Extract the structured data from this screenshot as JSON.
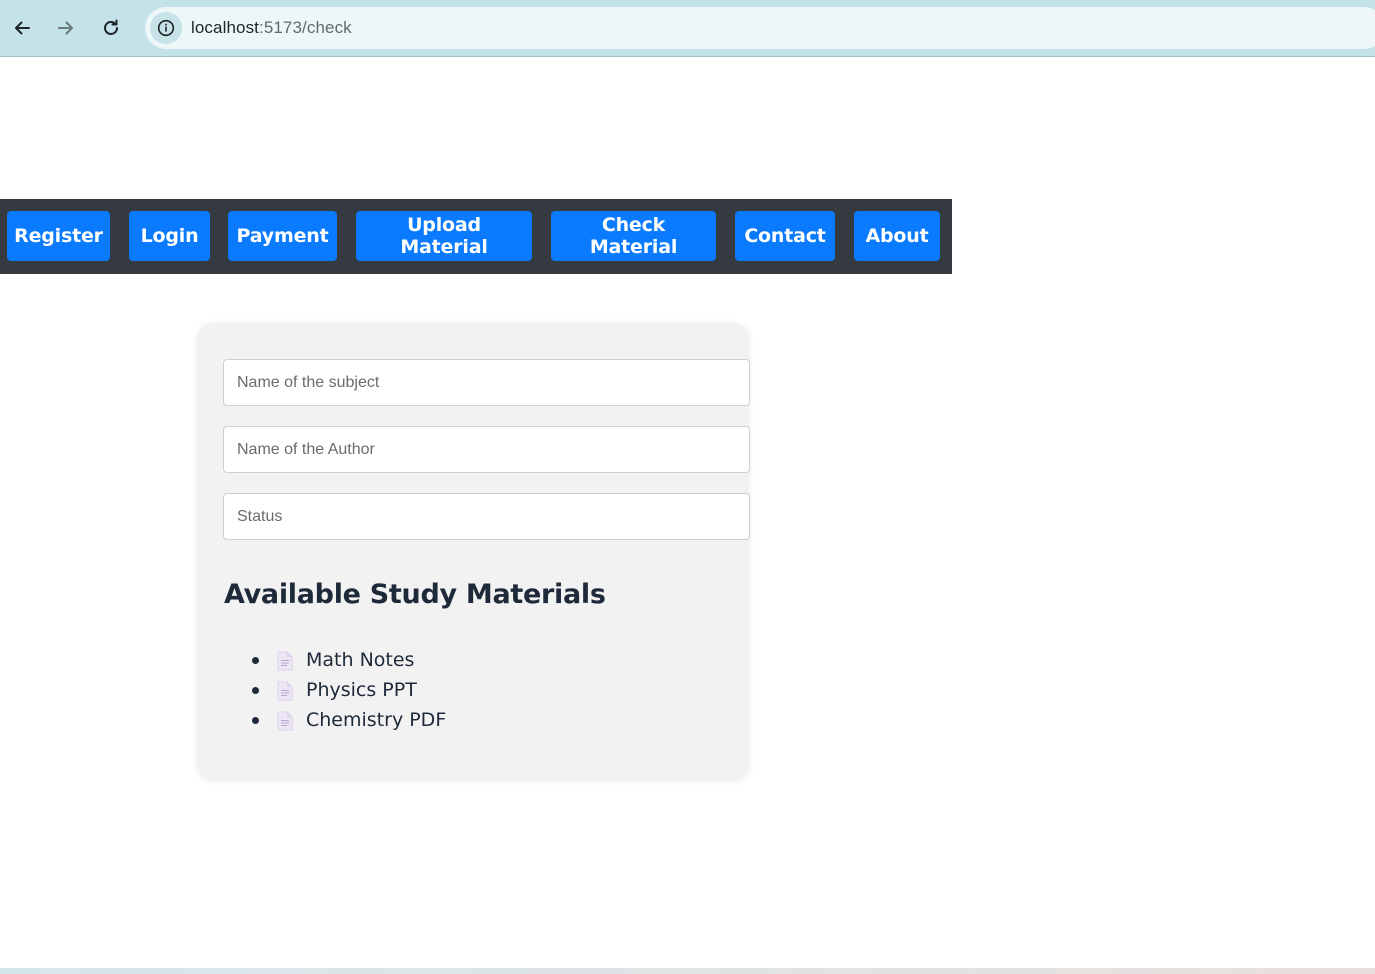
{
  "browser": {
    "url_host": "localhost",
    "url_path": ":5173/check"
  },
  "nav": {
    "items": [
      {
        "label": "Register"
      },
      {
        "label": "Login"
      },
      {
        "label": "Payment"
      },
      {
        "label": "Upload Material"
      },
      {
        "label": "Check Material"
      },
      {
        "label": "Contact"
      },
      {
        "label": "About"
      }
    ]
  },
  "form": {
    "subject_placeholder": "Name of the subject",
    "author_placeholder": "Name of the Author",
    "status_placeholder": "Status",
    "subject_value": "",
    "author_value": "",
    "status_value": ""
  },
  "materials": {
    "title": "Available Study Materials",
    "items": [
      {
        "label": "Math Notes",
        "icon": "document-icon"
      },
      {
        "label": "Physics PPT",
        "icon": "document-icon"
      },
      {
        "label": "Chemistry PDF",
        "icon": "document-icon"
      }
    ]
  },
  "colors": {
    "browser_bar": "#c4e3e8",
    "navbar": "#343a40",
    "nav_button": "#0a7bff",
    "card": "#f2f2f2",
    "heading": "#1e2a3a"
  }
}
